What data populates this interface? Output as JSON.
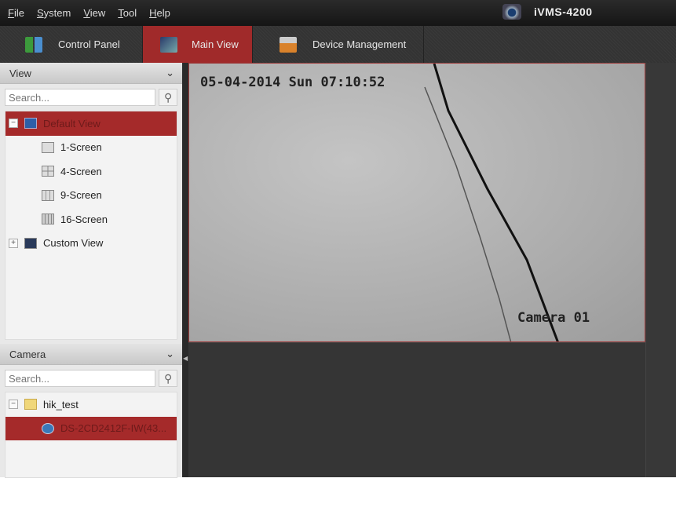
{
  "menu": [
    "File",
    "System",
    "View",
    "Tool",
    "Help"
  ],
  "app_title": "iVMS-4200",
  "tabs": [
    {
      "label": "Control Panel",
      "icon": "control-panel-icon"
    },
    {
      "label": "Main View",
      "icon": "main-view-icon",
      "active": true
    },
    {
      "label": "Device Management",
      "icon": "device-management-icon"
    }
  ],
  "view_panel": {
    "title": "View",
    "search_placeholder": "Search...",
    "default_view": "Default View",
    "screens": [
      "1-Screen",
      "4-Screen",
      "9-Screen",
      "16-Screen"
    ],
    "custom_view": "Custom View"
  },
  "camera_panel": {
    "title": "Camera",
    "search_placeholder": "Search...",
    "group": "hik_test",
    "camera": "DS-2CD2412F-IW(43..."
  },
  "video": {
    "timestamp": "05-04-2014 Sun 07:10:52",
    "camera_name": "Camera 01"
  },
  "colors": {
    "accent": "#a52a2a",
    "background": "#2f2f2f"
  }
}
